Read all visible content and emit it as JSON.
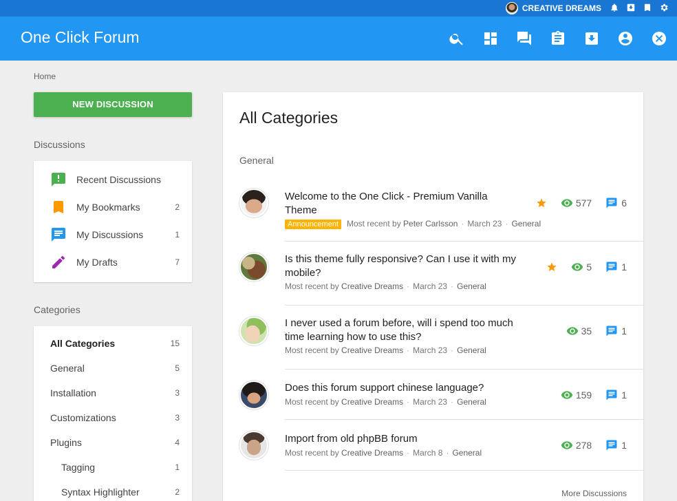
{
  "topbar": {
    "user_name": "CREATIVE DREAMS"
  },
  "header": {
    "title": "One Click Forum"
  },
  "breadcrumb": "Home",
  "new_discussion_label": "NEW DISCUSSION",
  "discussions": {
    "heading": "Discussions",
    "items": [
      {
        "label": "Recent Discussions",
        "count": ""
      },
      {
        "label": "My Bookmarks",
        "count": "2"
      },
      {
        "label": "My Discussions",
        "count": "1"
      },
      {
        "label": "My Drafts",
        "count": "7"
      }
    ]
  },
  "categories": {
    "heading": "Categories",
    "items": [
      {
        "label": "All Categories",
        "count": "15"
      },
      {
        "label": "General",
        "count": "5"
      },
      {
        "label": "Installation",
        "count": "3"
      },
      {
        "label": "Customizations",
        "count": "3"
      },
      {
        "label": "Plugins",
        "count": "4"
      },
      {
        "label": "Tagging",
        "count": "1"
      },
      {
        "label": "Syntax Highlighter",
        "count": "2"
      }
    ]
  },
  "main": {
    "title": "All Categories",
    "subtitle": "General",
    "more_label": "More Discussions",
    "rows": [
      {
        "title": "Welcome to the One Click - Premium Vanilla Theme",
        "badge": "Announcement",
        "by_label": "Most recent by",
        "author": "Peter Carlsson",
        "date": "March 23",
        "category": "General",
        "views": "577",
        "comments": "6"
      },
      {
        "title": "Is this theme fully responsive? Can I use it with my mobile?",
        "by_label": "Most recent by",
        "author": "Creative Dreams",
        "date": "March 23",
        "category": "General",
        "views": "5",
        "comments": "1"
      },
      {
        "title": "I never used a forum before, will i spend too much time learning how to use this?",
        "by_label": "Most recent by",
        "author": "Creative Dreams",
        "date": "March 23",
        "category": "General",
        "views": "35",
        "comments": "1"
      },
      {
        "title": "Does this forum support chinese language?",
        "by_label": "Most recent by",
        "author": "Creative Dreams",
        "date": "March 23",
        "category": "General",
        "views": "159",
        "comments": "1"
      },
      {
        "title": "Import from old phpBB forum",
        "by_label": "Most recent by",
        "author": "Creative Dreams",
        "date": "March 8",
        "category": "General",
        "views": "278",
        "comments": "1"
      }
    ]
  },
  "colors": {
    "primary": "#2196f3",
    "primary_dark": "#1976d2",
    "accent_green": "#4caf50",
    "star": "#ff9800",
    "badge": "#ffb300"
  },
  "icons": [
    "search-icon",
    "dashboard-icon",
    "forum-icon",
    "clipboard-icon",
    "download-icon",
    "account-icon",
    "close-icon",
    "bell-icon",
    "bookmark-icon",
    "gear-icon",
    "eye-icon",
    "comment-icon",
    "star-icon"
  ]
}
